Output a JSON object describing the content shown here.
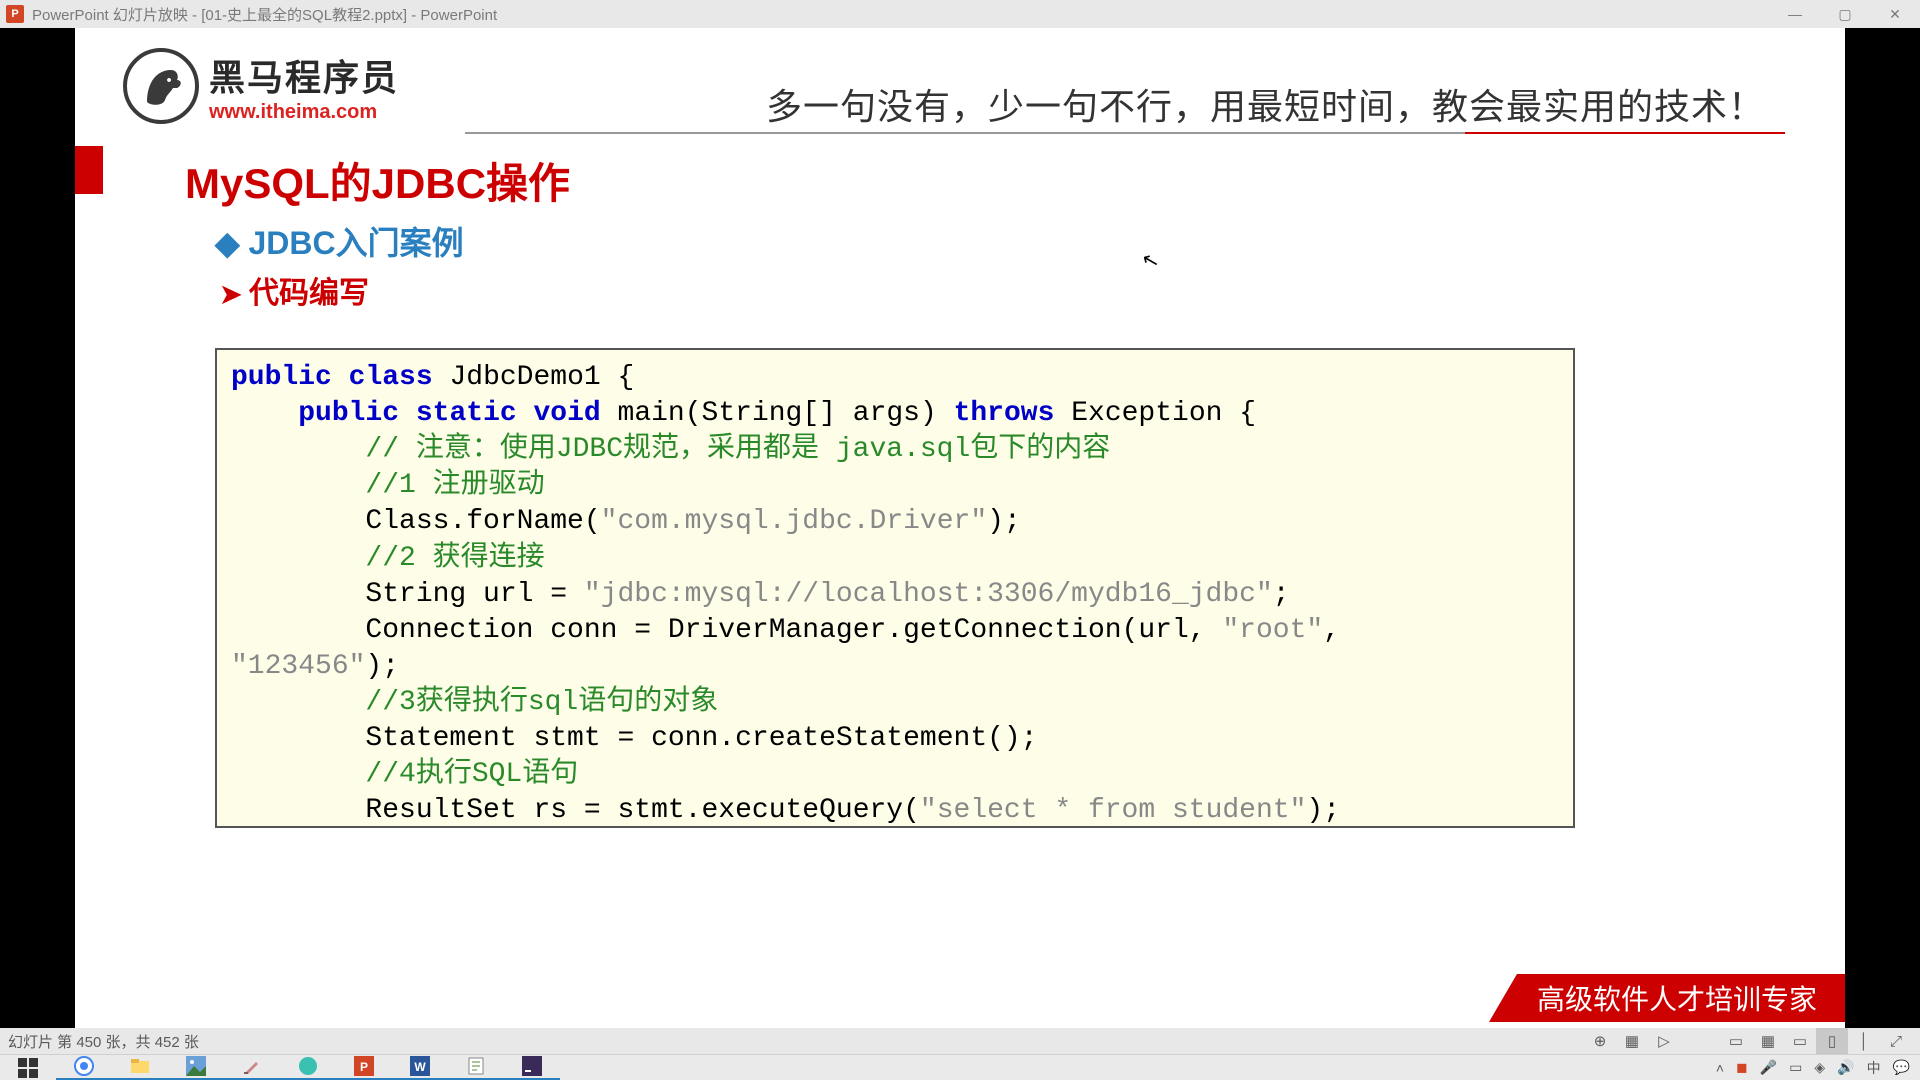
{
  "titlebar": {
    "icon_label": "P",
    "text": "PowerPoint 幻灯片放映 - [01-史上最全的SQL教程2.pptx] - PowerPoint"
  },
  "slide": {
    "logo_cn": "黑马程序员",
    "logo_url": "www.itheima.com",
    "tagline": "多一句没有，少一句不行，用最短时间，教会最实用的技术！",
    "title": "MySQL的JDBC操作",
    "bullet1": "JDBC入门案例",
    "bullet2": "代码编写",
    "footer": "高级软件人才培训专家"
  },
  "code": {
    "l1_a": "public",
    "l1_b": "class",
    "l1_c": " JdbcDemo1 {",
    "l2_a": "public",
    "l2_b": "static",
    "l2_c": "void",
    "l2_d": " main(String[] args) ",
    "l2_e": "throws",
    "l2_f": " Exception {",
    "l3": "// 注意：使用JDBC规范，采用都是 java.sql包下的内容",
    "l4": "//1 注册驱动",
    "l5_a": "Class.forName(",
    "l5_b": "\"com.mysql.jdbc.Driver\"",
    "l5_c": ");",
    "l6": "//2 获得连接",
    "l7_a": "String url = ",
    "l7_b": "\"jdbc:mysql://localhost:3306/mydb16_jdbc\"",
    "l7_c": ";",
    "l8_a": "Connection conn = DriverManager.getConnection(url, ",
    "l8_b": "\"root\"",
    "l8_c": ", ",
    "l8_d": "\"123456\"",
    "l8_e": ");",
    "l9": "//3获得执行sql语句的对象",
    "l10": "Statement stmt = conn.createStatement();",
    "l11": "//4执行SQL语句",
    "l12_a": "ResultSet rs = stmt.executeQuery(",
    "l12_b": "\"select * from student\"",
    "l12_c": ");"
  },
  "statusbar": {
    "text": "幻灯片 第 450 张，共 452 张"
  },
  "icons": {
    "minimize": "—",
    "maximize": "▢",
    "close": "✕",
    "magnify": "⊕",
    "presentation": "▦",
    "play": "▷",
    "normal": "▭",
    "sorter": "▦",
    "reading": "▭",
    "slideshow": "▯",
    "divider": "│",
    "fit": "⤢",
    "chevron": "˄",
    "battery": "▭",
    "wifi": "◈",
    "sound": "🔊",
    "ime": "中",
    "notif": "💬"
  }
}
